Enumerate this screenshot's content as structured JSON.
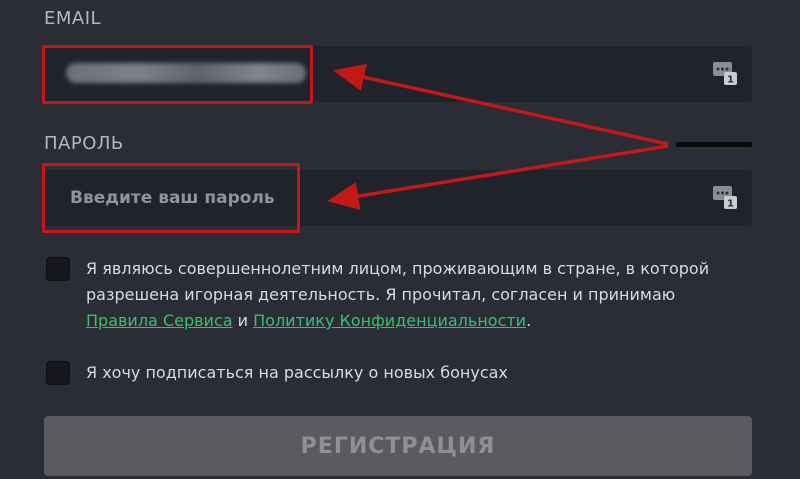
{
  "form": {
    "email": {
      "label": "EMAIL",
      "value": "",
      "icon": "password-manager-icon"
    },
    "password": {
      "label": "ПАРОЛЬ",
      "placeholder": "Введите ваш пароль",
      "icon": "password-manager-icon"
    },
    "terms": {
      "text_before": "Я являюсь совершеннолетним лицом, проживающим в стране, в которой разрешена игорная деятельность. Я прочитал, согласен и принимаю ",
      "link_rules": "Правила Сервиса",
      "conjunction": " и ",
      "link_privacy": "Политику Конфиденциальности",
      "text_after": ".",
      "checked": false
    },
    "newsletter": {
      "text": "Я хочу подписаться на рассылку о новых бонусах",
      "checked": false
    },
    "register_label": "РЕГИСТРАЦИЯ"
  },
  "colors": {
    "background": "#2a2d36",
    "field": "#20232b",
    "highlight": "#c21818",
    "link": "#39c06a",
    "button": "#595b61"
  }
}
